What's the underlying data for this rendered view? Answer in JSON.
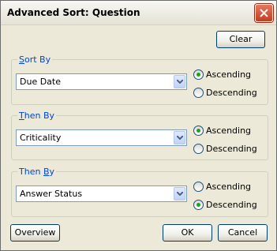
{
  "window": {
    "title": "Advanced Sort: Question"
  },
  "buttons": {
    "clear": "Clear",
    "overview": "Overview",
    "ok": "OK",
    "cancel": "Cancel"
  },
  "groups": [
    {
      "legend_first": "S",
      "legend_rest": "ort By",
      "value": "Due Date",
      "ascending": "Ascending",
      "descending": "Descending",
      "selected": "ascending"
    },
    {
      "legend_first": "T",
      "legend_rest": "hen By",
      "value": "Criticality",
      "ascending": "Ascending",
      "descending": "Descending",
      "selected": "ascending"
    },
    {
      "legend_first": "Then ",
      "legend_underline": "B",
      "legend_rest": "y",
      "value": "Answer Status",
      "ascending": "Ascending",
      "descending": "Descending",
      "selected": "descending"
    }
  ],
  "colors": {
    "accent": "#0046d5",
    "radio_selected": "#21a121",
    "window_bg": "#ece9d8"
  }
}
